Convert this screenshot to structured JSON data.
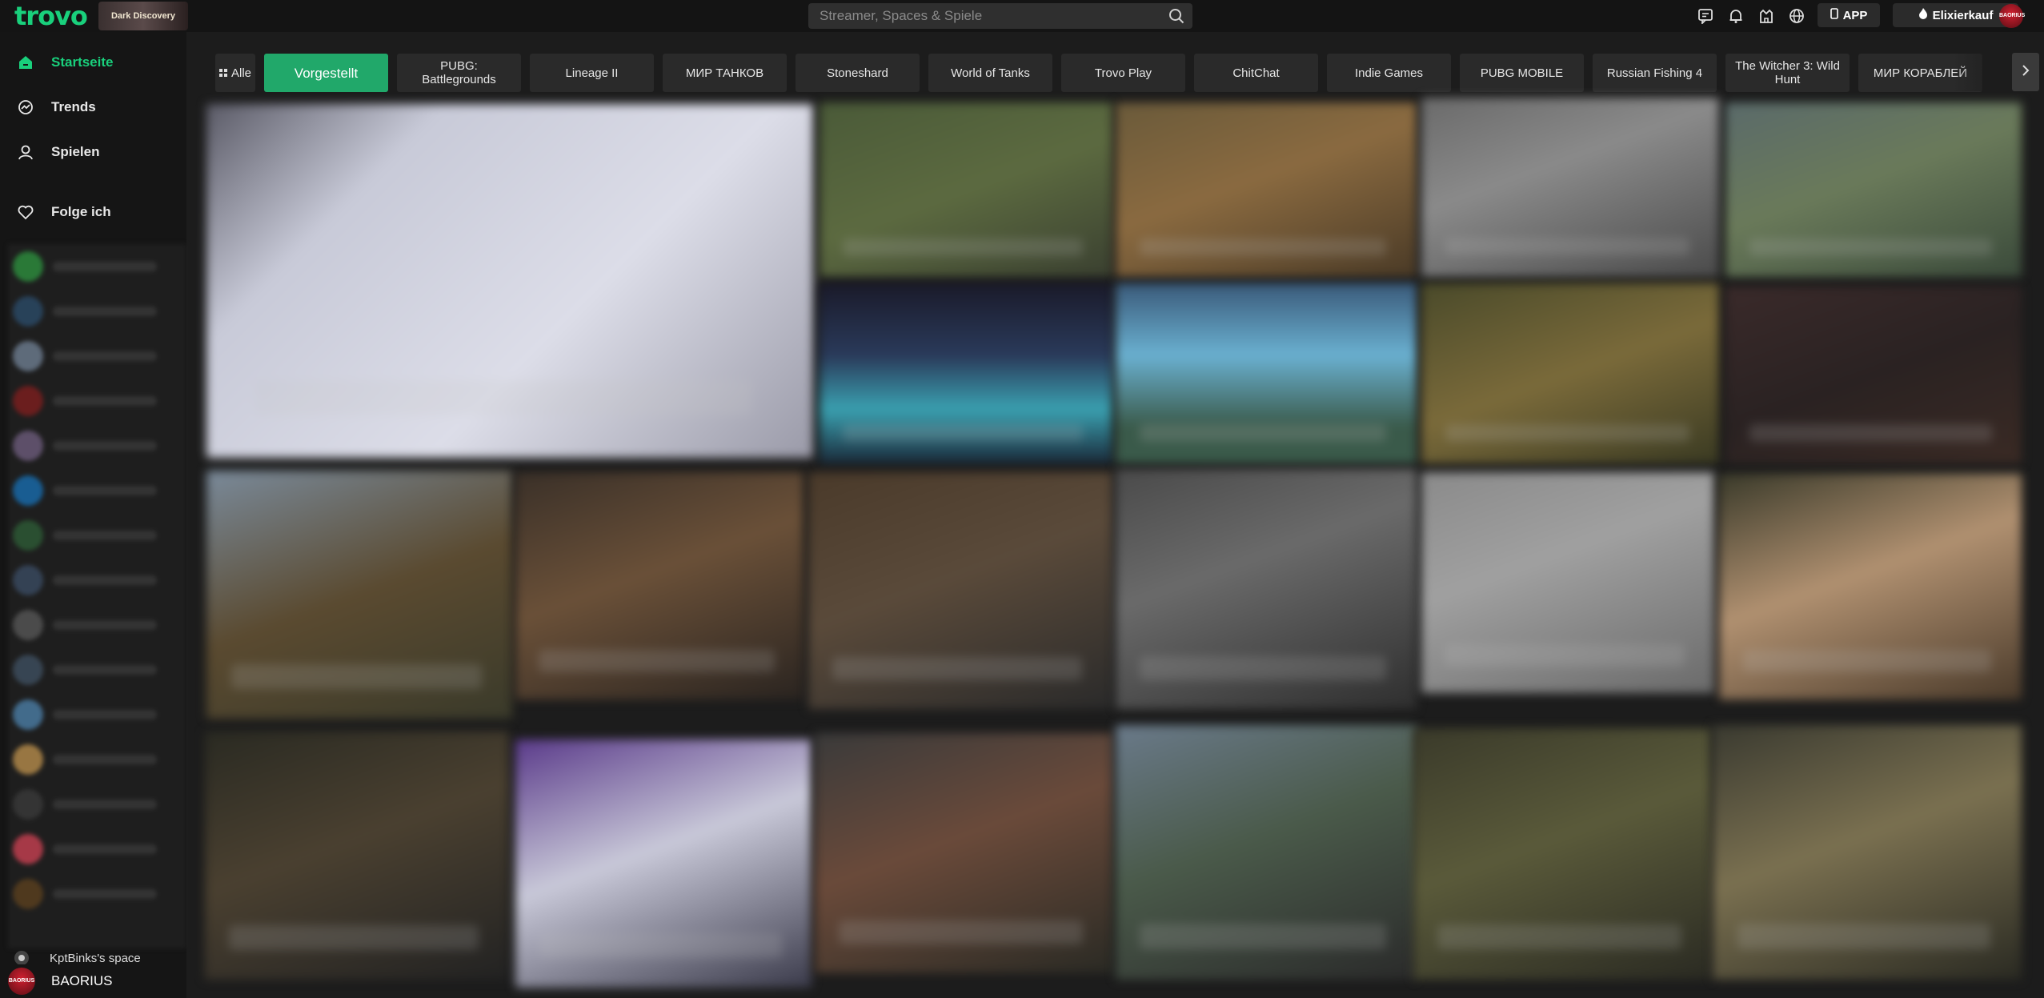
{
  "header": {
    "logo_text": "trovo",
    "event_badge": "Dark Discovery",
    "search_placeholder": "Streamer, Spaces & Spiele",
    "app_label": "APP",
    "shop_label": "Elixierkauf",
    "user_badge": "BAORIUS"
  },
  "sidebar": {
    "nav": [
      {
        "label": "Startseite",
        "icon": "home-icon"
      },
      {
        "label": "Trends",
        "icon": "trend-icon"
      },
      {
        "label": "Spielen",
        "icon": "play-icon"
      },
      {
        "label": "Folge ich",
        "icon": "heart-icon"
      }
    ],
    "bottom_channel": "KptBinks's space",
    "current_user": "BAORIUS"
  },
  "categories": [
    {
      "label": "Alle"
    },
    {
      "label": "Vorgestellt"
    },
    {
      "label": "PUBG: Battlegrounds"
    },
    {
      "label": "Lineage II"
    },
    {
      "label": "МИР ТАНКОВ"
    },
    {
      "label": "Stoneshard"
    },
    {
      "label": "World of Tanks"
    },
    {
      "label": "Trovo Play"
    },
    {
      "label": "ChitChat"
    },
    {
      "label": "Indie Games"
    },
    {
      "label": "PUBG MOBILE"
    },
    {
      "label": "Russian Fishing 4"
    },
    {
      "label": "The Witcher 3: Wild Hunt"
    },
    {
      "label": "МИР КОРАБЛЕЙ"
    }
  ],
  "colors": {
    "accent": "#19d07c",
    "active_category": "#21a86a"
  }
}
